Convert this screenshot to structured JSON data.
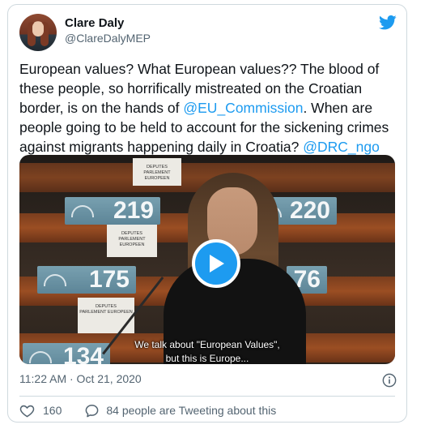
{
  "tweet": {
    "author_name": "Clare Daly",
    "author_handle": "@ClareDalyMEP",
    "text_part1": "European values? What European values?? The blood of these people, so horrifically mistreated on the Croatian border, is on the hands of ",
    "mention1": "@EU_Commission",
    "text_part2": ". When are people going to be held to account for the sickening crimes against migrants happening daily in Croatia? ",
    "mention2": "@DRC_ngo",
    "timestamp": "11:22 AM · Oct 21, 2020",
    "like_count": "160",
    "talking_text": "84 people are Tweeting about this"
  },
  "video": {
    "caption_line1": "We talk about \"European Values\",",
    "caption_line2": "but this is Europe...",
    "seats": [
      "219",
      "220",
      "175",
      "76",
      "134"
    ],
    "placard_lines": [
      "DEPUTES",
      "PARLEMENT EUROPEEN"
    ]
  },
  "icons": {
    "brand": "twitter-bird-icon",
    "info": "info-icon",
    "like": "heart-icon",
    "conversation": "speech-bubble-icon",
    "play": "play-icon"
  },
  "colors": {
    "accent": "#1d9bf0",
    "text": "#0f1419",
    "secondary": "#536471",
    "border": "#cfd9de"
  }
}
